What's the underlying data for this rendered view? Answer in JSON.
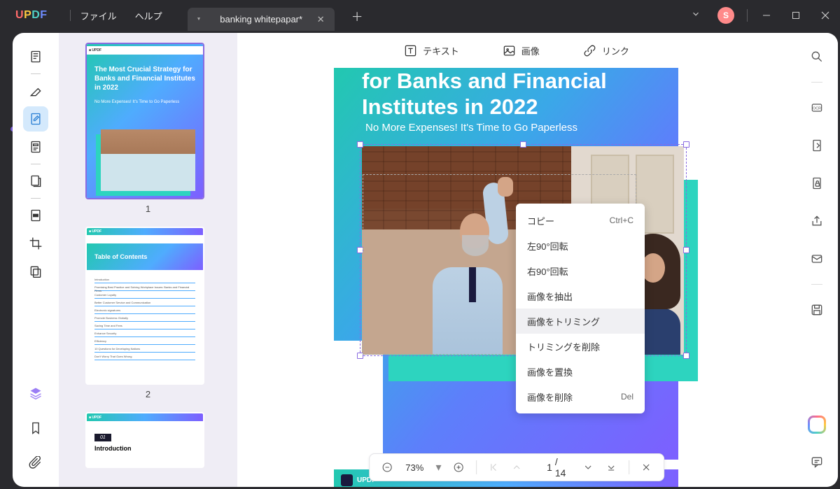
{
  "menu": {
    "file": "ファイル",
    "help": "ヘルプ"
  },
  "tab": {
    "title": "banking whitepapar*"
  },
  "avatar": {
    "initial": "S"
  },
  "thumbnails": {
    "p1": {
      "num": "1",
      "title": "The Most Crucial Strategy for Banks and Financial Institutes in 2022",
      "sub": "No More Expenses! It's Time to Go Paperless"
    },
    "p2": {
      "num": "2",
      "title": "Table of Contents",
      "items": [
        "Introduction",
        "Promising Best Practice and Solving Workplace Issues: Banks and Financial Firms",
        "Customer Loyalty",
        "Better Customer Service and Communication",
        "Electronic signatures",
        "Promote Business Globally",
        "Saving Time and Fees",
        "Enhance Security",
        "Efficiency",
        "10 Questions for Developing Nations",
        "Don't Worry That Goes Wrong"
      ]
    },
    "p3": {
      "chnum": "01",
      "chtitle": "Introduction"
    }
  },
  "editToolbar": {
    "text": "テキスト",
    "image": "画像",
    "link": "リンク"
  },
  "page": {
    "titleLine": "for Banks and Financial",
    "titleLine2": "Institutes in 2022",
    "sub": "No More Expenses! It's Time to Go Paperless",
    "brand": "UPDF"
  },
  "contextMenu": {
    "copy": "コピー",
    "copyShort": "Ctrl+C",
    "rotateLeft": "左90°回転",
    "rotateRight": "右90°回転",
    "extract": "画像を抽出",
    "crop": "画像をトリミング",
    "removeCrop": "トリミングを削除",
    "replace": "画像を置換",
    "delete": "画像を削除",
    "deleteShort": "Del"
  },
  "bottomBar": {
    "zoom": "73%",
    "page": "1",
    "total": "/  14"
  }
}
